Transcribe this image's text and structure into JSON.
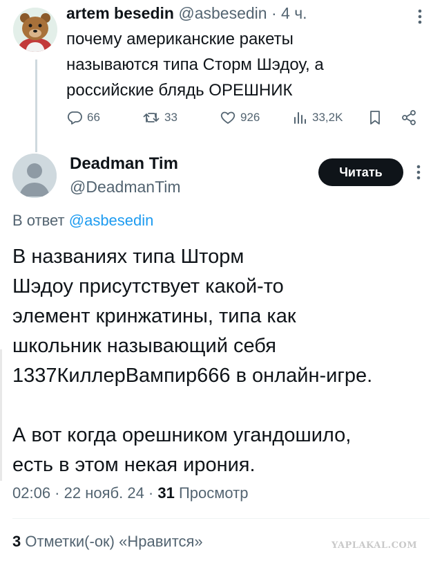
{
  "tweet1": {
    "author_name": "artem besedin",
    "handle": "@asbesedin",
    "separator": " · ",
    "time": "4 ч.",
    "text": "почему американские ракеты\nназываются типа Сторм Шэдоу, а\nроссийские блядь ОРЕШНИК",
    "actions": {
      "replies": "66",
      "reposts": "33",
      "likes": "926",
      "views": "33,2K"
    }
  },
  "tweet2": {
    "author_name": "Deadman Tim",
    "handle": "@DeadmanTim",
    "read_button": "Читать",
    "reply_prefix": "В ответ ",
    "reply_handle": "@asbesedin",
    "text": "В названиях типа Шторм\nШэдоу присутствует какой-то\nэлемент кринжатины, типа как\nшкольник называющий себя\n1337КиллерВампир666 в онлайн-игре.\n\nА вот когда орешником угандошило,\nесть в этом некая ирония.",
    "time": "02:06",
    "sep1": " · ",
    "date": "22 нояб. 24",
    "sep2": " · ",
    "views_count": "31",
    "views_label": " Просмотр",
    "likes_count": "3",
    "likes_label": " Отметки(-ок) «Нравится»"
  },
  "watermark": "YAPLAKAL.COM",
  "colors": {
    "text": "#0f1419",
    "muted": "#536471",
    "link": "#1d9bf0",
    "button_bg": "#0f1419"
  },
  "icons": [
    "more-icon",
    "reply-icon",
    "repost-icon",
    "like-icon",
    "views-icon",
    "bookmark-icon",
    "share-icon",
    "default-avatar-icon"
  ]
}
